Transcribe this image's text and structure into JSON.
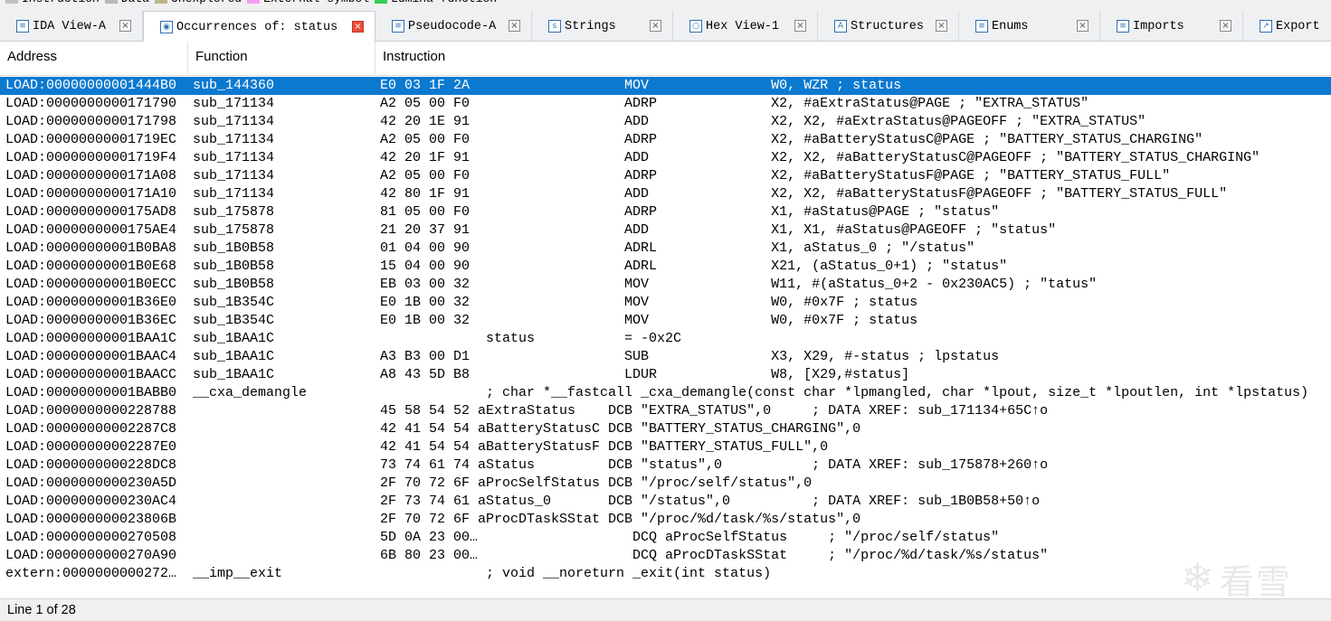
{
  "legend": {
    "items": [
      {
        "label": "Instruction",
        "color": "#c0c0c0"
      },
      {
        "label": "Data",
        "color": "#b7b7b7"
      },
      {
        "label": "Unexplored",
        "color": "#bcb58a"
      },
      {
        "label": "External symbol",
        "color": "#f59cf2"
      },
      {
        "label": "Lumina function",
        "color": "#33cc55"
      }
    ]
  },
  "tabs": [
    {
      "label": "IDA View-A",
      "icon": "ida-view-icon",
      "glyph": "≡"
    },
    {
      "label": "Occurrences of: status",
      "icon": "occurrences-icon",
      "glyph": "◉",
      "active": true
    },
    {
      "label": "Pseudocode-A",
      "icon": "pseudocode-icon",
      "glyph": "≡"
    },
    {
      "label": "Strings",
      "icon": "strings-icon",
      "glyph": "s"
    },
    {
      "label": "Hex View-1",
      "icon": "hex-view-icon",
      "glyph": "○"
    },
    {
      "label": "Structures",
      "icon": "structures-icon",
      "glyph": "A"
    },
    {
      "label": "Enums",
      "icon": "enums-icon",
      "glyph": "≡"
    },
    {
      "label": "Imports",
      "icon": "imports-icon",
      "glyph": "≡"
    },
    {
      "label": "Export",
      "icon": "exports-icon",
      "glyph": "↗"
    }
  ],
  "columns": [
    "Address",
    "Function",
    "Instruction"
  ],
  "rows": [
    {
      "addr": "LOAD:00000000001444B0",
      "func": "sub_144360",
      "ins": "E0 03 1F 2A                   MOV               W0, WZR ; status",
      "selected": true
    },
    {
      "addr": "LOAD:0000000000171790",
      "func": "sub_171134",
      "ins": "A2 05 00 F0                   ADRP              X2, #aExtraStatus@PAGE ; \"EXTRA_STATUS\""
    },
    {
      "addr": "LOAD:0000000000171798",
      "func": "sub_171134",
      "ins": "42 20 1E 91                   ADD               X2, X2, #aExtraStatus@PAGEOFF ; \"EXTRA_STATUS\""
    },
    {
      "addr": "LOAD:00000000001719EC",
      "func": "sub_171134",
      "ins": "A2 05 00 F0                   ADRP              X2, #aBatteryStatusC@PAGE ; \"BATTERY_STATUS_CHARGING\""
    },
    {
      "addr": "LOAD:00000000001719F4",
      "func": "sub_171134",
      "ins": "42 20 1F 91                   ADD               X2, X2, #aBatteryStatusC@PAGEOFF ; \"BATTERY_STATUS_CHARGING\""
    },
    {
      "addr": "LOAD:0000000000171A08",
      "func": "sub_171134",
      "ins": "A2 05 00 F0                   ADRP              X2, #aBatteryStatusF@PAGE ; \"BATTERY_STATUS_FULL\""
    },
    {
      "addr": "LOAD:0000000000171A10",
      "func": "sub_171134",
      "ins": "42 80 1F 91                   ADD               X2, X2, #aBatteryStatusF@PAGEOFF ; \"BATTERY_STATUS_FULL\""
    },
    {
      "addr": "LOAD:0000000000175AD8",
      "func": "sub_175878",
      "ins": "81 05 00 F0                   ADRP              X1, #aStatus@PAGE ; \"status\""
    },
    {
      "addr": "LOAD:0000000000175AE4",
      "func": "sub_175878",
      "ins": "21 20 37 91                   ADD               X1, X1, #aStatus@PAGEOFF ; \"status\""
    },
    {
      "addr": "LOAD:00000000001B0BA8",
      "func": "sub_1B0B58",
      "ins": "01 04 00 90                   ADRL              X1, aStatus_0 ; \"/status\""
    },
    {
      "addr": "LOAD:00000000001B0E68",
      "func": "sub_1B0B58",
      "ins": "15 04 00 90                   ADRL              X21, (aStatus_0+1) ; \"status\""
    },
    {
      "addr": "LOAD:00000000001B0ECC",
      "func": "sub_1B0B58",
      "ins": "EB 03 00 32                   MOV               W11, #(aStatus_0+2 - 0x230AC5) ; \"tatus\""
    },
    {
      "addr": "LOAD:00000000001B36E0",
      "func": "sub_1B354C",
      "ins": "E0 1B 00 32                   MOV               W0, #0x7F ; status"
    },
    {
      "addr": "LOAD:00000000001B36EC",
      "func": "sub_1B354C",
      "ins": "E0 1B 00 32                   MOV               W0, #0x7F ; status"
    },
    {
      "addr": "LOAD:00000000001BAA1C",
      "func": "sub_1BAA1C",
      "ins": "             status           = -0x2C"
    },
    {
      "addr": "LOAD:00000000001BAAC4",
      "func": "sub_1BAA1C",
      "ins": "A3 B3 00 D1                   SUB               X3, X29, #-status ; lpstatus"
    },
    {
      "addr": "LOAD:00000000001BAACC",
      "func": "sub_1BAA1C",
      "ins": "A8 43 5D B8                   LDUR              W8, [X29,#status]"
    },
    {
      "addr": "LOAD:00000000001BABB0",
      "func": "__cxa_demangle",
      "ins": "             ; char *__fastcall _cxa_demangle(const char *lpmangled, char *lpout, size_t *lpoutlen, int *lpstatus)"
    },
    {
      "addr": "LOAD:0000000000228788",
      "func": "",
      "ins": "45 58 54 52 aExtraStatus    DCB \"EXTRA_STATUS\",0     ; DATA XREF: sub_171134+65C↑o"
    },
    {
      "addr": "LOAD:00000000002287C8",
      "func": "",
      "ins": "42 41 54 54 aBatteryStatusC DCB \"BATTERY_STATUS_CHARGING\",0"
    },
    {
      "addr": "LOAD:00000000002287E0",
      "func": "",
      "ins": "42 41 54 54 aBatteryStatusF DCB \"BATTERY_STATUS_FULL\",0"
    },
    {
      "addr": "LOAD:0000000000228DC8",
      "func": "",
      "ins": "73 74 61 74 aStatus         DCB \"status\",0           ; DATA XREF: sub_175878+260↑o"
    },
    {
      "addr": "LOAD:0000000000230A5D",
      "func": "",
      "ins": "2F 70 72 6F aProcSelfStatus DCB \"/proc/self/status\",0"
    },
    {
      "addr": "LOAD:0000000000230AC4",
      "func": "",
      "ins": "2F 73 74 61 aStatus_0       DCB \"/status\",0          ; DATA XREF: sub_1B0B58+50↑o"
    },
    {
      "addr": "LOAD:000000000023806B",
      "func": "",
      "ins": "2F 70 72 6F aProcDTaskSStat DCB \"/proc/%d/task/%s/status\",0"
    },
    {
      "addr": "LOAD:0000000000270508",
      "func": "",
      "ins": "5D 0A 23 00…                   DCQ aProcSelfStatus     ; \"/proc/self/status\""
    },
    {
      "addr": "LOAD:0000000000270A90",
      "func": "",
      "ins": "6B 80 23 00…                   DCQ aProcDTaskSStat     ; \"/proc/%d/task/%s/status\""
    },
    {
      "addr": "extern:0000000000272…",
      "func": "__imp__exit",
      "ins": "             ; void __noreturn _exit(int status)"
    }
  ],
  "watermark": {
    "text": "看雪"
  },
  "status_bar": {
    "text": "Line 1 of 28"
  }
}
